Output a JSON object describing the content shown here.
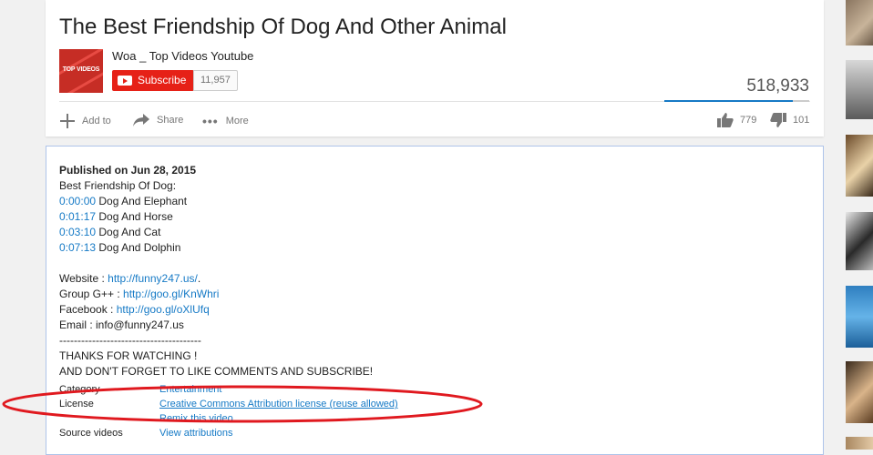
{
  "video": {
    "title": "The Best Friendship Of Dog And Other Animal",
    "channel_name": "Woa _ Top Videos Youtube",
    "channel_logo_text": "TOP VIDEOS",
    "subscribe_label": "Subscribe",
    "subscriber_count": "11,957",
    "view_count": "518,933",
    "like_ratio": 0.885
  },
  "actions": {
    "add_to": "Add to",
    "share": "Share",
    "more": "More",
    "likes": "779",
    "dislikes": "101"
  },
  "description": {
    "published": "Published on Jun 28, 2015",
    "intro": "Best Friendship Of Dog:",
    "chapters": [
      {
        "time": "0:00:00",
        "text": " Dog And Elephant"
      },
      {
        "time": "0:01:17",
        "text": " Dog And Horse"
      },
      {
        "time": "0:03:10",
        "text": " Dog And Cat"
      },
      {
        "time": "0:07:13",
        "text": " Dog And Dolphin"
      }
    ],
    "website_label": "Website : ",
    "website_link": "http://funny247.us/",
    "website_suffix": ".",
    "group_label": "Group G++ : ",
    "group_link": "http://goo.gl/KnWhri",
    "facebook_label": "Facebook : ",
    "facebook_link": "http://goo.gl/oXlUfq",
    "email": "Email : info@funny247.us",
    "separator": "---------------------------------------",
    "thanks": "THANKS FOR WATCHING !",
    "reminder": "AND DON'T FORGET TO LIKE COMMENTS AND SUBSCRIBE!"
  },
  "meta": {
    "category_label": "Category",
    "category_value": "Entertainment",
    "license_label": "License",
    "license_value": "Creative Commons Attribution license (reuse allowed)",
    "remix_value": "Remix this video",
    "source_label": "Source videos",
    "source_value": "View attributions"
  },
  "colors": {
    "subscribe_red": "#e62117",
    "link_blue": "#167ac6",
    "annotation_red": "#e0191f"
  }
}
